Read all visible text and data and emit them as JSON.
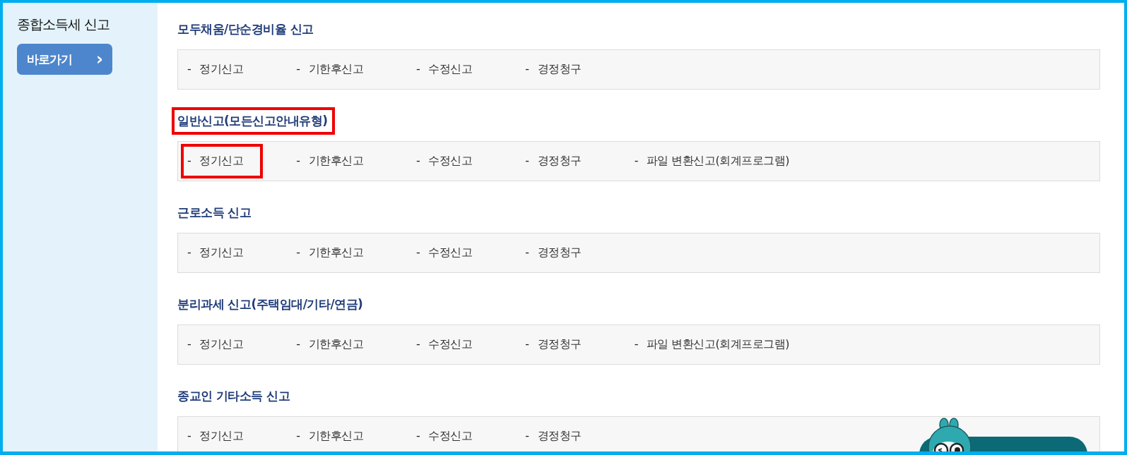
{
  "sidebar": {
    "title": "종합소득세 신고",
    "button": {
      "label": "바로가기",
      "arrow": "›"
    }
  },
  "sections": [
    {
      "title": "모두채움/단순경비율 신고",
      "highlighted": false,
      "items": [
        {
          "bullet": "-",
          "label": "정기신고",
          "highlighted": false
        },
        {
          "bullet": "-",
          "label": "기한후신고",
          "highlighted": false
        },
        {
          "bullet": "-",
          "label": "수정신고",
          "highlighted": false
        },
        {
          "bullet": "-",
          "label": "경정청구",
          "highlighted": false
        }
      ]
    },
    {
      "title": "일반신고(모든신고안내유형)",
      "highlighted": true,
      "items": [
        {
          "bullet": "-",
          "label": "정기신고",
          "highlighted": true
        },
        {
          "bullet": "-",
          "label": "기한후신고",
          "highlighted": false
        },
        {
          "bullet": "-",
          "label": "수정신고",
          "highlighted": false
        },
        {
          "bullet": "-",
          "label": "경정청구",
          "highlighted": false
        },
        {
          "bullet": "-",
          "label": "파일 변환신고(회계프로그램)",
          "highlighted": false
        }
      ]
    },
    {
      "title": "근로소득 신고",
      "highlighted": false,
      "items": [
        {
          "bullet": "-",
          "label": "정기신고",
          "highlighted": false
        },
        {
          "bullet": "-",
          "label": "기한후신고",
          "highlighted": false
        },
        {
          "bullet": "-",
          "label": "수정신고",
          "highlighted": false
        },
        {
          "bullet": "-",
          "label": "경정청구",
          "highlighted": false
        }
      ]
    },
    {
      "title": "분리과세 신고(주택임대/기타/연금)",
      "highlighted": false,
      "items": [
        {
          "bullet": "-",
          "label": "정기신고",
          "highlighted": false
        },
        {
          "bullet": "-",
          "label": "기한후신고",
          "highlighted": false
        },
        {
          "bullet": "-",
          "label": "수정신고",
          "highlighted": false
        },
        {
          "bullet": "-",
          "label": "경정청구",
          "highlighted": false
        },
        {
          "bullet": "-",
          "label": "파일 변환신고(회계프로그램)",
          "highlighted": false
        }
      ]
    },
    {
      "title": "종교인 기타소득 신고",
      "highlighted": false,
      "items": [
        {
          "bullet": "-",
          "label": "정기신고",
          "highlighted": false
        },
        {
          "bullet": "-",
          "label": "기한후신고",
          "highlighted": false
        },
        {
          "bullet": "-",
          "label": "수정신고",
          "highlighted": false
        },
        {
          "bullet": "-",
          "label": "경정청구",
          "highlighted": false
        }
      ]
    }
  ]
}
